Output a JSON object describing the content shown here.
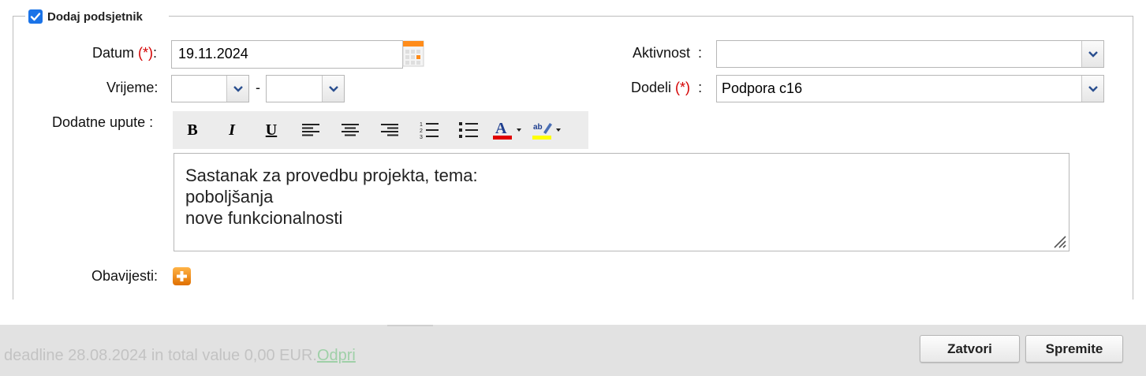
{
  "reminder": {
    "legend_label": "Dodaj podsjetnik",
    "checked": true
  },
  "form": {
    "date": {
      "label": "Datum",
      "required_mark": "(*)",
      "suffix": ":",
      "value": "19.11.2024"
    },
    "time": {
      "label": "Vrijeme:",
      "separator": "-",
      "from_value": "",
      "to_value": ""
    },
    "activity": {
      "label": "Aktivnost",
      "suffix": ":",
      "value": ""
    },
    "assign": {
      "label": "Dodeli",
      "required_mark": "(*)",
      "suffix": ":",
      "value": "Podpora c16"
    },
    "instructions": {
      "label": "Dodatne upute :",
      "lines": [
        "Sastanak za provedbu projekta, tema:",
        "poboljšanja",
        "nove funkcionalnosti"
      ]
    },
    "notifications": {
      "label": "Obavijesti:"
    }
  },
  "toolbar": {
    "buttons": [
      "bold",
      "italic",
      "underline",
      "align-left",
      "align-center",
      "align-right",
      "ordered-list",
      "unordered-list",
      "font-color",
      "highlight-color"
    ],
    "bold_glyph": "B",
    "italic_glyph": "I",
    "underline_glyph": "U",
    "font_color_glyph": "A",
    "highlight_glyph": "ab",
    "font_color": "#e00000",
    "highlight_color": "#ffff00"
  },
  "footer": {
    "text": "deadline 28.08.2024 in total value 0,00 EUR.",
    "link": "Odpri",
    "close_button": "Zatvori",
    "save_button": "Spremite"
  },
  "colors": {
    "checkbox": "#1a73e8",
    "required": "#d40000",
    "footer_bg": "#e2e2e2"
  }
}
